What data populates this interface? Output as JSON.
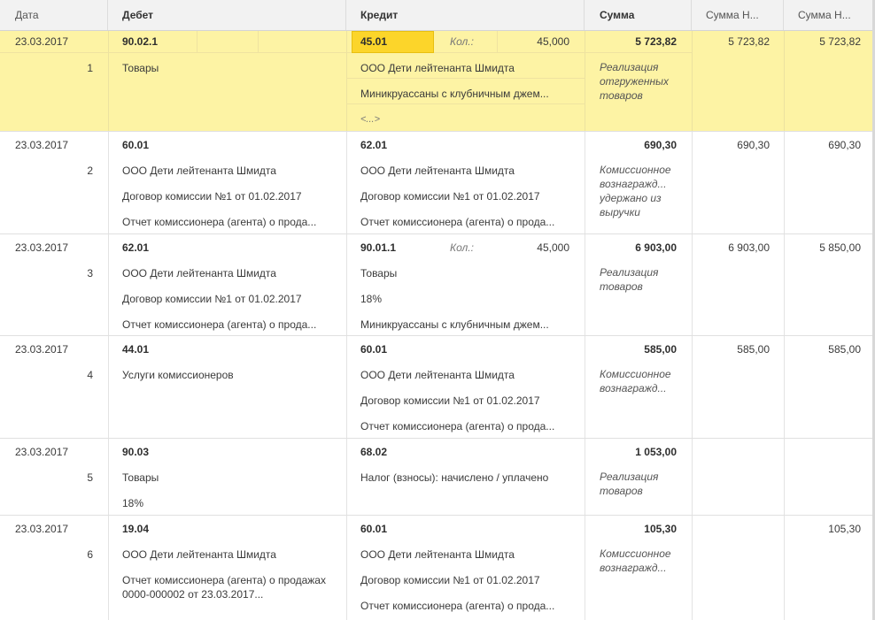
{
  "headers": {
    "date": "Дата",
    "debit": "Дебет",
    "credit": "Кредит",
    "sum": "Сумма",
    "sum_n1": "Сумма Н...",
    "sum_n2": "Сумма Н..."
  },
  "kol_label": "Кол.:",
  "rows": [
    {
      "date": "23.03.2017",
      "num": "1",
      "debit": "90.02.1",
      "debit_lines": [
        "Товары"
      ],
      "credit": "45.01",
      "credit_lines": [
        "ООО Дети лейтенанта Шмидта",
        "Миникруассаны с клубничным джем...",
        "<...>"
      ],
      "credit_qty": "45,000",
      "sum": "5 723,82",
      "content": "Реализация отгруженных товаров",
      "sum_n1": "5 723,82",
      "sum_n2": "5 723,82"
    },
    {
      "date": "23.03.2017",
      "num": "2",
      "debit": "60.01",
      "debit_lines": [
        "ООО Дети лейтенанта Шмидта",
        "Договор комиссии №1 от 01.02.2017",
        "Отчет комиссионера (агента) о прода..."
      ],
      "credit": "62.01",
      "credit_lines": [
        "ООО Дети лейтенанта Шмидта",
        "Договор комиссии №1 от 01.02.2017",
        "Отчет комиссионера (агента) о прода..."
      ],
      "sum": "690,30",
      "content": "Комиссионное вознагражд...\n удержано из выручки",
      "sum_n1": "690,30",
      "sum_n2": "690,30"
    },
    {
      "date": "23.03.2017",
      "num": "3",
      "debit": "62.01",
      "debit_lines": [
        "ООО Дети лейтенанта Шмидта",
        "Договор комиссии №1 от 01.02.2017",
        "Отчет комиссионера (агента) о прода..."
      ],
      "credit": "90.01.1",
      "credit_lines": [
        "Товары",
        "18%",
        "Миникруассаны с клубничным джем..."
      ],
      "credit_qty": "45,000",
      "sum": "6 903,00",
      "content": "Реализация товаров",
      "sum_n1": "6 903,00",
      "sum_n2": "5 850,00"
    },
    {
      "date": "23.03.2017",
      "num": "4",
      "debit": "44.01",
      "debit_lines": [
        "Услуги комиссионеров"
      ],
      "credit": "60.01",
      "credit_lines": [
        "ООО Дети лейтенанта Шмидта",
        "Договор комиссии №1 от 01.02.2017",
        "Отчет комиссионера (агента) о прода..."
      ],
      "sum": "585,00",
      "content": "Комиссионное вознагражд...",
      "sum_n1": "585,00",
      "sum_n2": "585,00"
    },
    {
      "date": "23.03.2017",
      "num": "5",
      "debit": "90.03",
      "debit_lines": [
        "Товары",
        "18%"
      ],
      "credit": "68.02",
      "credit_lines": [
        "Налог (взносы): начислено / уплачено"
      ],
      "sum": "1 053,00",
      "content": "Реализация товаров",
      "sum_n1": "",
      "sum_n2": ""
    },
    {
      "date": "23.03.2017",
      "num": "6",
      "debit": "19.04",
      "debit_lines": [
        "ООО Дети лейтенанта Шмидта",
        "Отчет комиссионера (агента) о продажах 0000-000002 от 23.03.2017..."
      ],
      "credit": "60.01",
      "credit_lines": [
        "ООО Дети лейтенанта Шмидта",
        "Договор комиссии №1 от 01.02.2017",
        "Отчет комиссионера (агента) о прода..."
      ],
      "sum": "105,30",
      "content": "Комиссионное вознагражд...",
      "sum_n1": "",
      "sum_n2": "105,30"
    }
  ]
}
